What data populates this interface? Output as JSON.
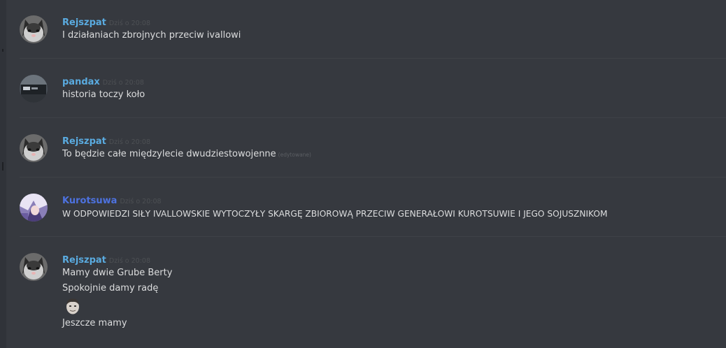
{
  "colors": {
    "background": "#36393f",
    "username_blue": "#5aabe0",
    "username_indigo": "#4d72e0",
    "text": "#dcddde",
    "timestamp": "#4d5054",
    "divider": "#3f4247"
  },
  "messages": [
    {
      "username": "Rejszpat",
      "timestamp": "Dziś o 20:08",
      "lines": [
        "I działaniach zbrojnych przeciw ivallowi"
      ]
    },
    {
      "username": "pandax",
      "timestamp": "Dziś o 20:08",
      "lines": [
        "historia toczy koło"
      ]
    },
    {
      "username": "Rejszpat",
      "timestamp": "Dziś o 20:08",
      "lines": [
        "To będzie całe międzylecie dwudziestowojenne"
      ],
      "edited": "(edytowane)"
    },
    {
      "username": "Kurotsuwa",
      "timestamp": "Dziś o 20:08",
      "lines": [
        "W ODPOWIEDZI SIŁY IVALLOWSKIE WYTOCZYŁY SKARGĘ ZBIOROWĄ PRZECIW GENERAŁOWI KUROTSUWIE I JEGO SOJUSZNIKOM"
      ]
    },
    {
      "username": "Rejszpat",
      "timestamp": "Dziś o 20:08",
      "lines": [
        "Mamy dwie Grube Berty",
        "Spokojnie damy radę",
        "Jeszcze mamy"
      ],
      "emoji": "kappa-face-emoji"
    }
  ]
}
